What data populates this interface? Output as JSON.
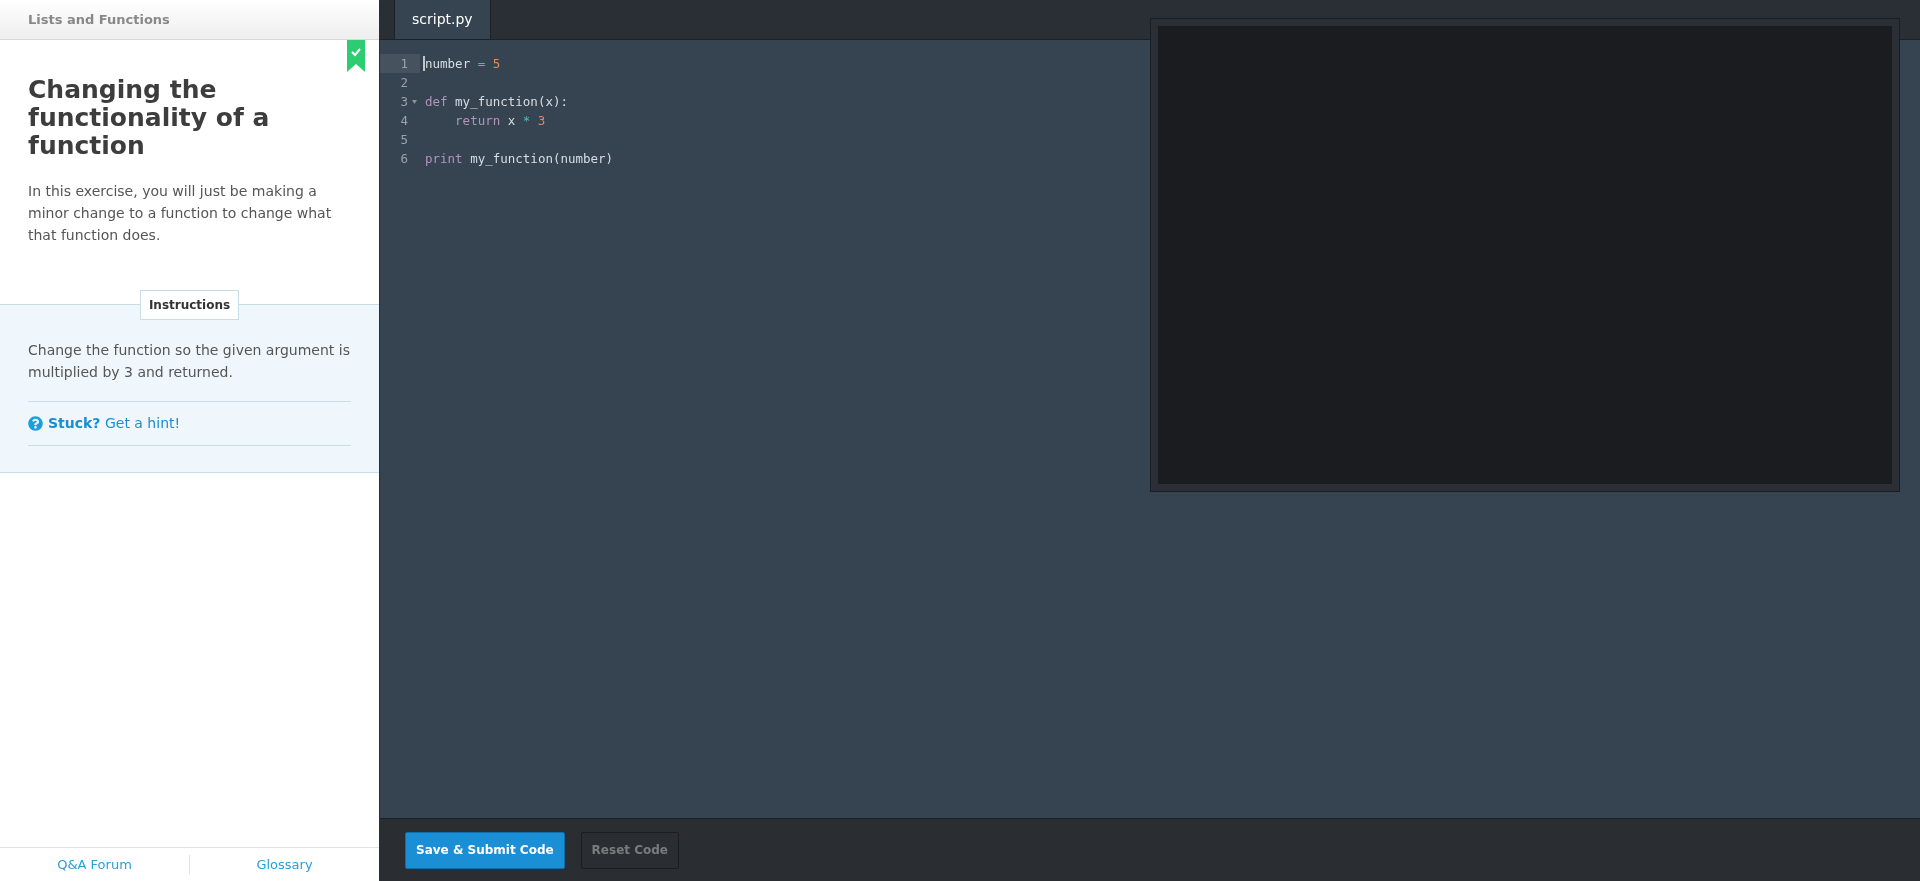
{
  "lesson": {
    "section": "Lists and Functions",
    "completed": true,
    "title": "Changing the functionality of a function",
    "description": "In this exercise, you will just be making a minor change to a function to change what that function does.",
    "instructions_label": "Instructions",
    "instructions": "Change the function so the given argument is multiplied by 3 and returned.",
    "hint_lead": "Stuck?",
    "hint_link": "Get a hint!"
  },
  "footer_links": [
    "Q&A Forum",
    "Glossary"
  ],
  "editor": {
    "tabs": [
      {
        "label": "script.py",
        "selected": true
      }
    ],
    "lines": [
      {
        "number": "1",
        "active": true,
        "fold": false,
        "tokens": [
          {
            "kind": "plain",
            "text": "number"
          },
          {
            "kind": "operator",
            "text": "="
          },
          {
            "kind": "number",
            "text": "5"
          }
        ]
      },
      {
        "number": "2",
        "active": false,
        "fold": false
      },
      {
        "number": "3",
        "active": false,
        "fold": true,
        "tokens": [
          {
            "kind": "keyword",
            "text": "def"
          },
          {
            "kind": "plain",
            "text": "my_function(x):"
          }
        ]
      },
      {
        "number": "4",
        "active": false,
        "fold": false,
        "indent": true,
        "tokens": [
          {
            "kind": "keyword",
            "text": "return"
          },
          {
            "kind": "plain",
            "text": "x"
          },
          {
            "kind": "operator",
            "text": "*"
          },
          {
            "kind": "number",
            "text": "3"
          }
        ]
      },
      {
        "number": "5",
        "active": false,
        "fold": false
      },
      {
        "number": "6",
        "active": false,
        "fold": false,
        "tokens": [
          {
            "kind": "keyword",
            "text": "print"
          },
          {
            "kind": "plain",
            "text": "my_function(number)"
          }
        ]
      }
    ]
  },
  "buttons": [
    {
      "label": "Save & Submit Code",
      "kind": "primary"
    },
    {
      "label": "Reset Code",
      "kind": "secondary"
    }
  ]
}
